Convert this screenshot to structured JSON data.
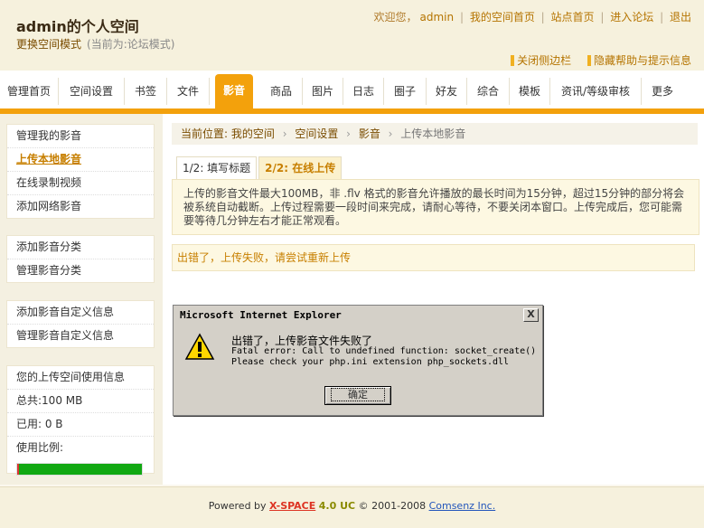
{
  "header": {
    "title": "admin的个人空间",
    "mode_switch": "更换空间模式",
    "current_mode": "(当前为:论坛模式)",
    "welcome": "欢迎您，",
    "username": "admin",
    "links": [
      "我的空间首页",
      "站点首页",
      "进入论坛",
      "退出"
    ],
    "sep": "|",
    "tools": [
      "关闭侧边栏",
      "隐藏帮助与提示信息"
    ]
  },
  "nav": {
    "items": [
      "管理首页",
      "空间设置",
      "书签",
      "文件",
      "影音",
      "商品",
      "图片",
      "日志",
      "圈子",
      "好友",
      "综合",
      "模板",
      "资讯/等级审核",
      "更多"
    ],
    "active": "影音"
  },
  "sidebar": {
    "group1": [
      "管理我的影音",
      "上传本地影音",
      "在线录制视频",
      "添加网络影音"
    ],
    "group2": [
      "添加影音分类",
      "管理影音分类"
    ],
    "group3": [
      "添加影音自定义信息",
      "管理影音自定义信息"
    ],
    "usage": {
      "title": "您的上传空间使用信息",
      "total": "总共:100 MB",
      "used": "已用: 0 B",
      "ratio_label": "使用比例:",
      "ratio": 0.0
    }
  },
  "main": {
    "breadcrumb": [
      "当前位置: 我的空间",
      "空间设置",
      "影音",
      "上传本地影音"
    ],
    "breadcrumb_sep": "›",
    "steps": [
      "1/2: 填写标题",
      "2/2: 在线上传"
    ],
    "info": "上传的影音文件最大100MB，非 .flv 格式的影音允许播放的最长时间为15分钟，超过15分钟的部分将会被系统自动截断。上传过程需要一段时间来完成，请耐心等待，不要关闭本窗口。上传完成后，您可能需要等待几分钟左右才能正常观看。",
    "error": "出错了，上传失败，请尝试重新上传"
  },
  "dialog": {
    "title": "Microsoft Internet Explorer",
    "close": "X",
    "message": "出错了，上传影音文件失败了",
    "detail1": "Fatal error: Call to undefined function: socket_create()",
    "detail2": "Please check your php.ini extension php_sockets.dll",
    "ok": "确定"
  },
  "footer": {
    "powered": "Powered by",
    "product": "X-SPACE",
    "version": "4.0 UC",
    "copyright": "© 2001-2008",
    "company": "Comsenz Inc."
  },
  "colors": {
    "accent": "#f3a10c",
    "usage_bar": "#11a812"
  }
}
